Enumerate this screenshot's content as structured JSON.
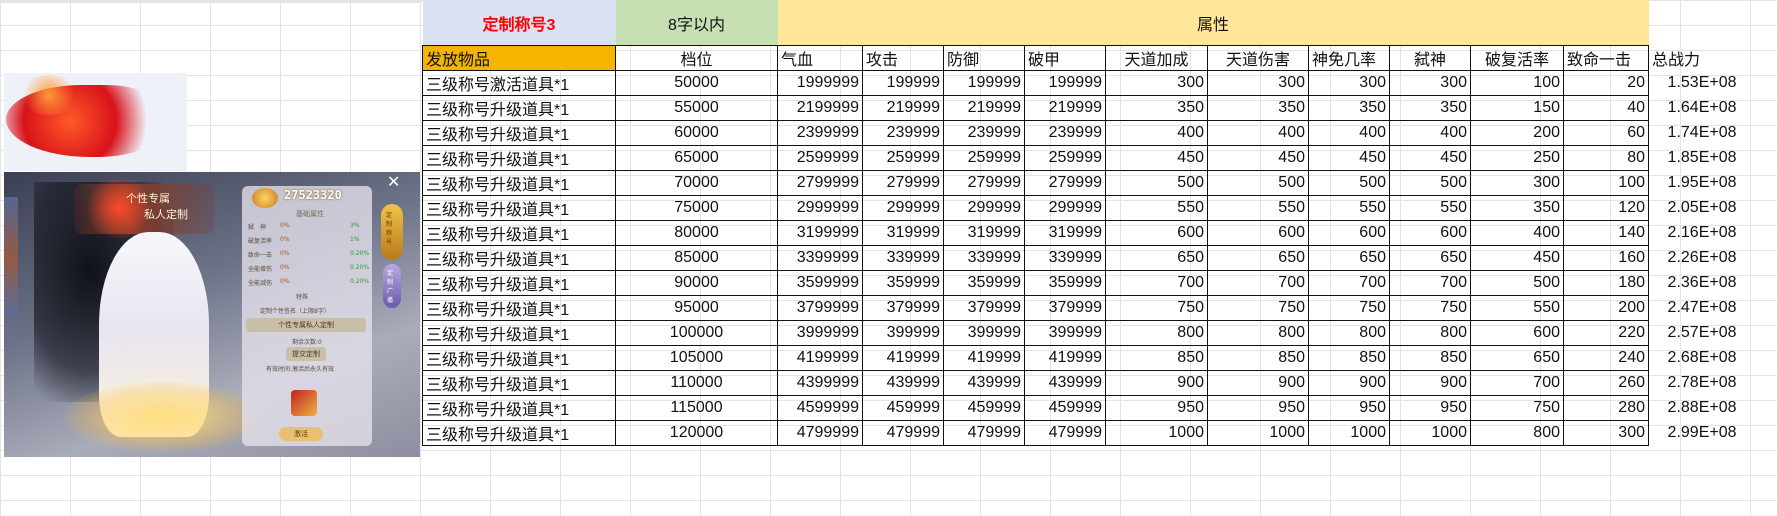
{
  "header": {
    "title": "定制称号3",
    "length_note": "8字以内",
    "attr_group": "属性"
  },
  "columns": [
    "发放物品",
    "档位",
    "气血",
    "攻击",
    "防御",
    "破甲",
    "天道加成",
    "天道伤害",
    "神免几率",
    "弑神",
    "破复活率",
    "致命一击",
    "总战力"
  ],
  "rows": [
    [
      "三级称号激活道具*1",
      "50000",
      "1999999",
      "199999",
      "199999",
      "199999",
      "300",
      "300",
      "300",
      "300",
      "100",
      "20",
      "1.53E+08"
    ],
    [
      "三级称号升级道具*1",
      "55000",
      "2199999",
      "219999",
      "219999",
      "219999",
      "350",
      "350",
      "350",
      "350",
      "150",
      "40",
      "1.64E+08"
    ],
    [
      "三级称号升级道具*1",
      "60000",
      "2399999",
      "239999",
      "239999",
      "239999",
      "400",
      "400",
      "400",
      "400",
      "200",
      "60",
      "1.74E+08"
    ],
    [
      "三级称号升级道具*1",
      "65000",
      "2599999",
      "259999",
      "259999",
      "259999",
      "450",
      "450",
      "450",
      "450",
      "250",
      "80",
      "1.85E+08"
    ],
    [
      "三级称号升级道具*1",
      "70000",
      "2799999",
      "279999",
      "279999",
      "279999",
      "500",
      "500",
      "500",
      "500",
      "300",
      "100",
      "1.95E+08"
    ],
    [
      "三级称号升级道具*1",
      "75000",
      "2999999",
      "299999",
      "299999",
      "299999",
      "550",
      "550",
      "550",
      "550",
      "350",
      "120",
      "2.05E+08"
    ],
    [
      "三级称号升级道具*1",
      "80000",
      "3199999",
      "319999",
      "319999",
      "319999",
      "600",
      "600",
      "600",
      "600",
      "400",
      "140",
      "2.16E+08"
    ],
    [
      "三级称号升级道具*1",
      "85000",
      "3399999",
      "339999",
      "339999",
      "339999",
      "650",
      "650",
      "650",
      "650",
      "450",
      "160",
      "2.26E+08"
    ],
    [
      "三级称号升级道具*1",
      "90000",
      "3599999",
      "359999",
      "359999",
      "359999",
      "700",
      "700",
      "700",
      "700",
      "500",
      "180",
      "2.36E+08"
    ],
    [
      "三级称号升级道具*1",
      "95000",
      "3799999",
      "379999",
      "379999",
      "379999",
      "750",
      "750",
      "750",
      "750",
      "550",
      "200",
      "2.47E+08"
    ],
    [
      "三级称号升级道具*1",
      "100000",
      "3999999",
      "399999",
      "399999",
      "399999",
      "800",
      "800",
      "800",
      "800",
      "600",
      "220",
      "2.57E+08"
    ],
    [
      "三级称号升级道具*1",
      "105000",
      "4199999",
      "419999",
      "419999",
      "419999",
      "850",
      "850",
      "850",
      "850",
      "650",
      "240",
      "2.68E+08"
    ],
    [
      "三级称号升级道具*1",
      "110000",
      "4399999",
      "439999",
      "439999",
      "439999",
      "900",
      "900",
      "900",
      "900",
      "700",
      "260",
      "2.78E+08"
    ],
    [
      "三级称号升级道具*1",
      "115000",
      "4599999",
      "459999",
      "459999",
      "459999",
      "950",
      "950",
      "950",
      "950",
      "750",
      "280",
      "2.88E+08"
    ],
    [
      "三级称号升级道具*1",
      "120000",
      "4799999",
      "479999",
      "479999",
      "479999",
      "1000",
      "1000",
      "1000",
      "1000",
      "800",
      "300",
      "2.99E+08"
    ]
  ],
  "game_screenshot": {
    "banner_line1": "个性专属",
    "banner_line2": "私人定制",
    "power": "27523320",
    "panel_title": "基础属性",
    "stats": [
      {
        "name": "弑　神",
        "value": "0%",
        "gain": "3%"
      },
      {
        "name": "破复活率",
        "value": "0%",
        "gain": "1%"
      },
      {
        "name": "致命一击",
        "value": "0%",
        "gain": "0.20%"
      },
      {
        "name": "全能增伤",
        "value": "0%",
        "gain": "0.20%"
      },
      {
        "name": "全能减伤",
        "value": "0%",
        "gain": "0.20%"
      }
    ],
    "section_label": "特殊",
    "name_hint": "定制个性签名（上限8字）",
    "private_custom_button": "个性专属私人定制",
    "remaining_label": "剩余次数:0",
    "submit_button": "提交定制",
    "validity": "有效时间:激活后永久有效",
    "activate_button": "激活",
    "side_tab_1": "定制称号",
    "side_tab_2": "定制广播",
    "close_glyph": "✕"
  }
}
